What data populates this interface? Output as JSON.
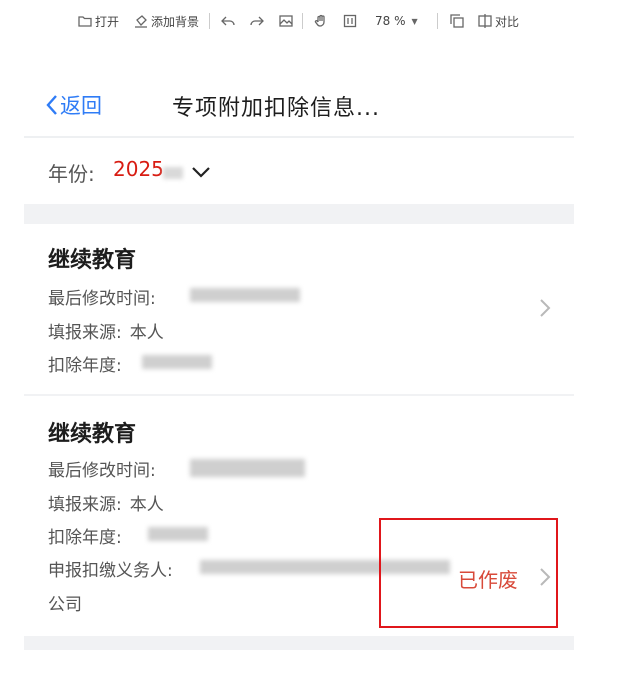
{
  "toolbar": {
    "open": "打开",
    "add_background": "添加背景",
    "zoom": "78 %",
    "compare": "对比"
  },
  "nav": {
    "back": "返回",
    "title": "专项附加扣除信息..."
  },
  "year": {
    "label": "年份:",
    "value": "2025"
  },
  "records": [
    {
      "title": "继续教育",
      "modified_label": "最后修改时间:",
      "source_label": "填报来源:",
      "source_value": "本人",
      "year_label": "扣除年度:"
    },
    {
      "title": "继续教育",
      "modified_label": "最后修改时间:",
      "source_label": "填报来源:",
      "source_value": "本人",
      "year_label": "扣除年度:",
      "agent_label": "申报扣缴义务人:",
      "agent_suffix": "公司",
      "status": "已作废"
    }
  ],
  "colors": {
    "accent": "#2f7cf6",
    "year_highlight": "#d81c12",
    "status": "#d84a3a",
    "highlight_box": "#e0161b"
  }
}
